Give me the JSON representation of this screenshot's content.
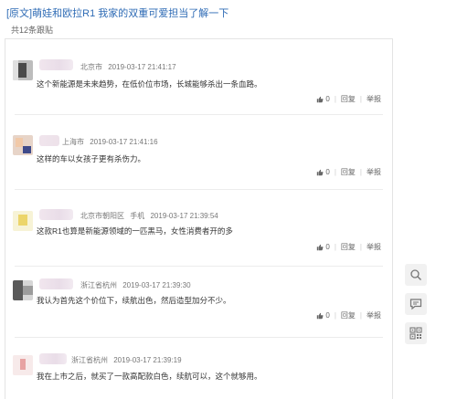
{
  "header": {
    "title_tag": "[原文]",
    "thread_title": "萌娃和欧拉R1 我家的双重可爱担当了解一下",
    "reply_count": "共12条跟贴"
  },
  "posts": [
    {
      "location": "北京市",
      "time": "2019-03-17 21:41:17",
      "text": "这个新能源是未来趋势，在低价位市场，长城能够杀出一条血路。",
      "likes": "0",
      "reply_label": "回复",
      "report_label": "举报"
    },
    {
      "location": "上海市",
      "time": "2019-03-17 21:41:16",
      "text": "这样的车以女孩子更有杀伤力。",
      "likes": "0",
      "reply_label": "回复",
      "report_label": "举报"
    },
    {
      "location": "北京市朝阳区",
      "device": "手机",
      "time": "2019-03-17 21:39:54",
      "text": "这款R1也算是新能源领域的一匹黑马，女性消费者开的多",
      "likes": "0",
      "reply_label": "回复",
      "report_label": "举报"
    },
    {
      "location": "浙江省杭州",
      "time": "2019-03-17 21:39:30",
      "text": "我认为首先这个价位下，续航出色，然后造型加分不少。",
      "likes": "0",
      "reply_label": "回复",
      "report_label": "举报"
    },
    {
      "location": "浙江省杭州",
      "time": "2019-03-17 21:39:19",
      "text": "我在上市之后，就买了一款高配款白色，续航可以，这个就够用。",
      "likes": "",
      "reply_label": "",
      "report_label": ""
    }
  ],
  "sidebar": {
    "icons": [
      "search-comment-icon",
      "comment-icon",
      "qrcode-icon"
    ]
  },
  "colors": {
    "link": "#2e6bb5"
  }
}
